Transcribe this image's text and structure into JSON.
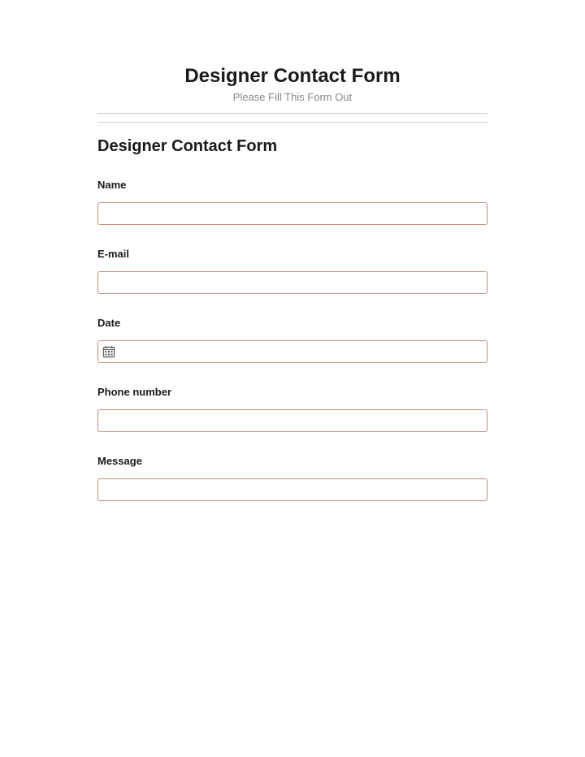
{
  "header": {
    "title": "Designer Contact Form",
    "subtitle": "Please Fill This Form Out"
  },
  "form": {
    "title": "Designer Contact Form",
    "fields": {
      "name": {
        "label": "Name",
        "value": ""
      },
      "email": {
        "label": "E-mail",
        "value": ""
      },
      "date": {
        "label": "Date",
        "value": ""
      },
      "phone": {
        "label": "Phone number",
        "value": ""
      },
      "message": {
        "label": "Message",
        "value": ""
      }
    }
  }
}
